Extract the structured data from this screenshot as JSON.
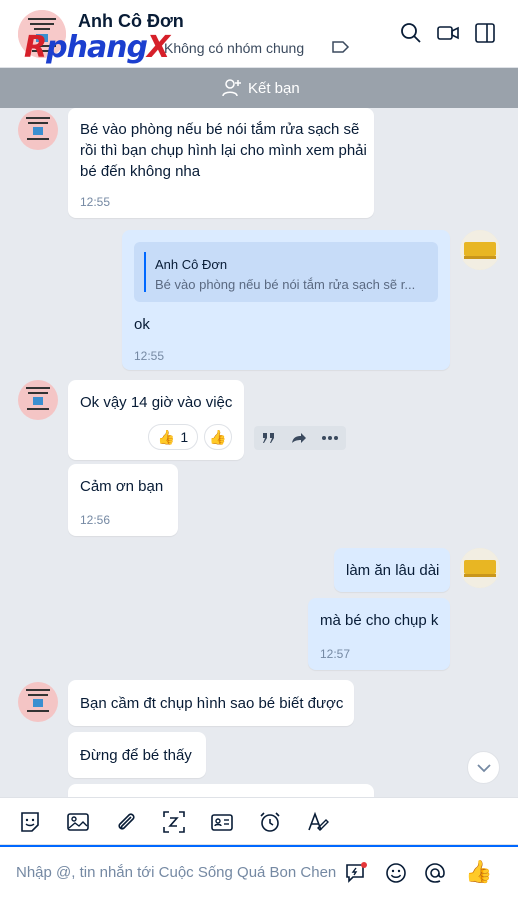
{
  "header": {
    "name": "Anh Cô Đơn",
    "subtitle": "Không có nhóm chung",
    "watermark": {
      "part1": "R",
      "part2": "phang",
      "part3": "X"
    },
    "icons": [
      "search-icon",
      "video-call-icon",
      "sidebar-toggle-icon"
    ]
  },
  "friend_bar": {
    "label": "Kết bạn"
  },
  "messages": {
    "m1": {
      "text": "Bé vào phòng nếu bé nói tắm rửa sạch sẽ rồi thì bạn chụp hình lại cho mình xem phải bé đến không nha",
      "time": "12:55"
    },
    "m2": {
      "quote_name": "Anh Cô Đơn",
      "quote_text": "Bé vào phòng nếu bé nói tắm rửa sạch sẽ r...",
      "text": "ok",
      "time": "12:55"
    },
    "m3": {
      "text": "Ok vậy 14 giờ vào việc",
      "reaction_count": "1"
    },
    "m4": {
      "text": "Cảm ơn bạn",
      "time": "12:56"
    },
    "m5": {
      "text": "làm ăn lâu dài"
    },
    "m6": {
      "text": "mà bé cho chụp k",
      "time": "12:57"
    },
    "m7": {
      "text": "Bạn cầm đt chụp hình sao bé biết được"
    },
    "m8": {
      "text": "Đừng để bé thấy"
    }
  },
  "toolbar": {
    "icons": [
      "sticker-icon",
      "image-icon",
      "attachment-icon",
      "screenshot-icon",
      "contact-card-icon",
      "reminder-icon",
      "text-format-icon"
    ]
  },
  "composer": {
    "placeholder": "Nhập @, tin nhắn tới Cuộc Sống Quá Bon Chen",
    "icons": [
      "quick-message-icon",
      "emoji-icon",
      "mention-icon",
      "like-icon"
    ]
  },
  "colors": {
    "accent": "#0068ff",
    "outgoing_bubble": "#dbebff",
    "incoming_bubble": "#ffffff",
    "chat_bg": "#e7eaef"
  }
}
